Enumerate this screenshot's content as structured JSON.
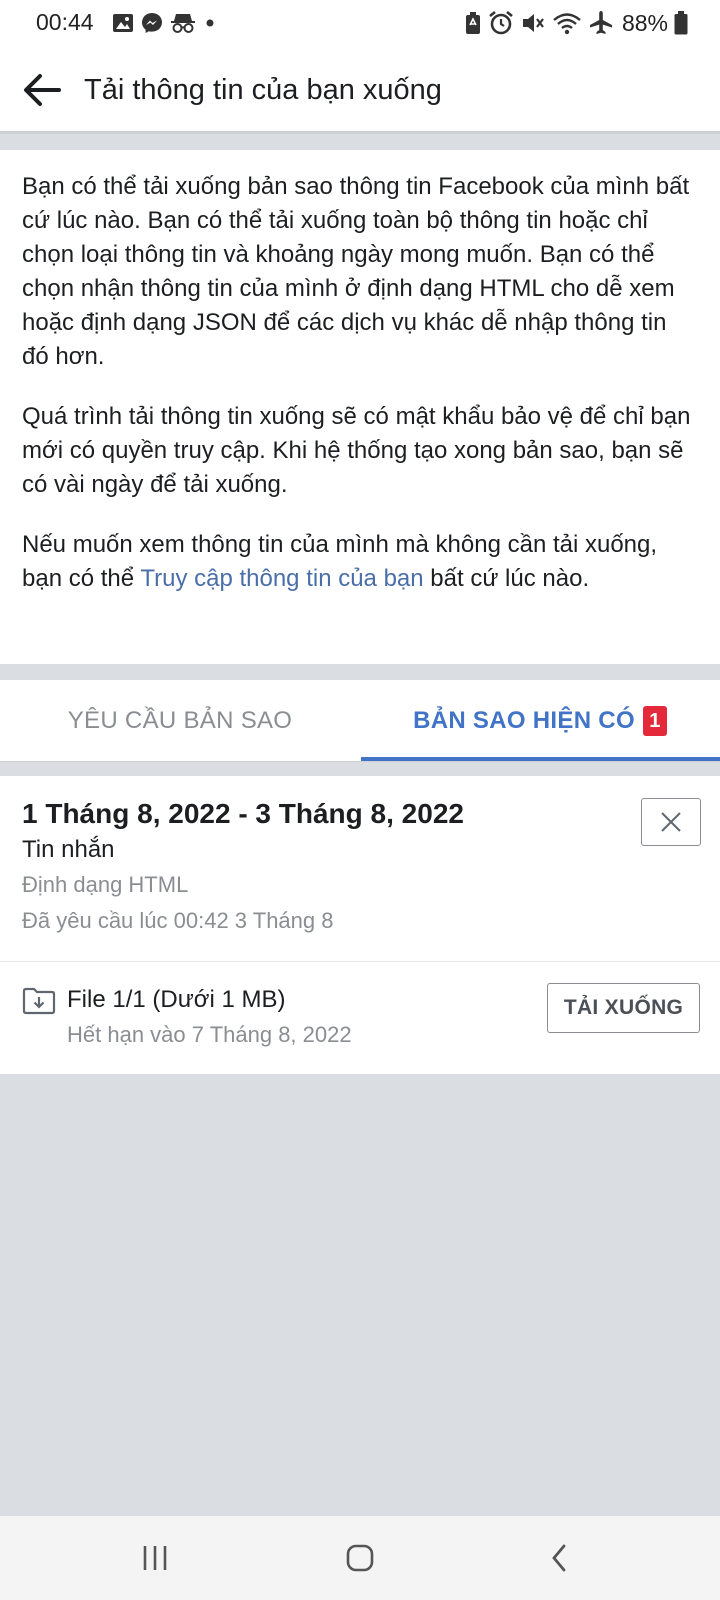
{
  "status_bar": {
    "time": "00:44",
    "battery": "88%"
  },
  "header": {
    "title": "Tải thông tin của bạn xuống"
  },
  "intro": {
    "paragraph1": "Bạn có thể tải xuống bản sao thông tin Facebook của mình bất cứ lúc nào. Bạn có thể tải xuống toàn bộ thông tin hoặc chỉ chọn loại thông tin và khoảng ngày mong muốn. Bạn có thể chọn nhận thông tin của mình ở định dạng HTML cho dễ xem hoặc định dạng JSON để các dịch vụ khác dễ nhập thông tin đó hơn.",
    "paragraph2": "Quá trình tải thông tin xuống sẽ có mật khẩu bảo vệ để chỉ bạn mới có quyền truy cập. Khi hệ thống tạo xong bản sao, bạn sẽ có vài ngày để tải xuống.",
    "paragraph3_before": "Nếu muốn xem thông tin của mình mà không cần tải xuống, bạn có thể ",
    "paragraph3_link": "Truy cập thông tin của bạn",
    "paragraph3_after": " bất cứ lúc nào."
  },
  "tabs": {
    "request_label": "YÊU CẦU BẢN SAO",
    "available_label": "BẢN SAO HIỆN CÓ",
    "available_badge": "1"
  },
  "copy": {
    "date_range": "1 Tháng 8, 2022 - 3 Tháng 8, 2022",
    "type": "Tin nhắn",
    "format": "Định dạng HTML",
    "requested": "Đã yêu cầu lúc 00:42 3 Tháng 8",
    "file_name": "File 1/1 (Dưới 1 MB)",
    "expiry": "Hết hạn vào 7 Tháng 8, 2022",
    "download_label": "TẢI XUỐNG"
  },
  "colors": {
    "accent": "#4173c7",
    "link": "#4a6ea9",
    "badge": "#e4293b",
    "muted_text": "#8a8d91",
    "background": "#dadde1"
  },
  "icons": {
    "status_left": [
      "gallery-icon",
      "messenger-icon",
      "incognito-icon",
      "dot-icon"
    ],
    "status_right": [
      "battery-saver-icon",
      "alarm-icon",
      "mute-icon",
      "wifi-icon",
      "airplane-icon",
      "battery-icon"
    ],
    "header": "back-arrow-icon",
    "card": [
      "close-icon",
      "download-folder-icon"
    ],
    "nav": [
      "recent-apps-icon",
      "home-icon",
      "back-nav-icon"
    ]
  }
}
